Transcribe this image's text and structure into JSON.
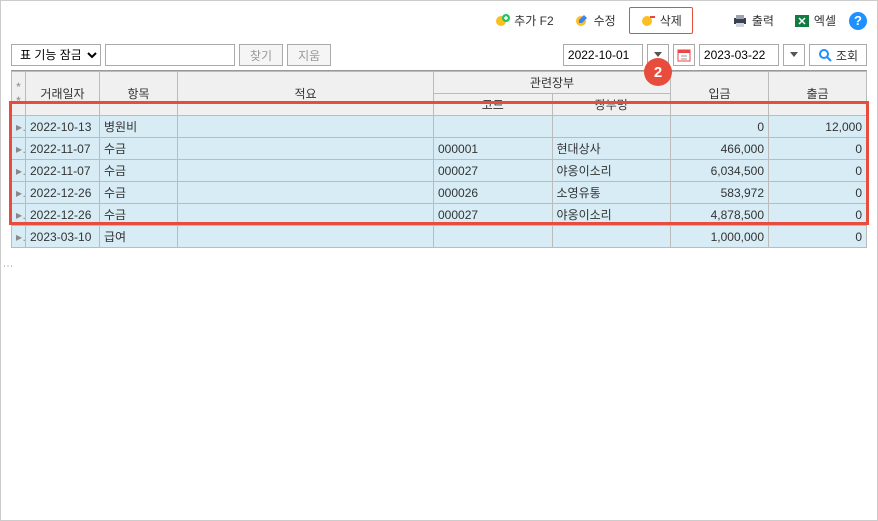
{
  "toolbar": {
    "add_label": "추가 F2",
    "edit_label": "수정",
    "delete_label": "삭제",
    "print_label": "출력",
    "excel_label": "엑셀",
    "help_glyph": "?"
  },
  "filter": {
    "lock_label": "표 기능 잠금",
    "find_label": "찾기",
    "clear_label": "지움",
    "date_from": "2022-10-01",
    "date_to": "2023-03-22",
    "search_label": "조회"
  },
  "columns": {
    "group_header": "관련장부",
    "date": "거래일자",
    "item": "항목",
    "memo": "적요",
    "code": "코드",
    "book": "장부명",
    "deposit": "입금",
    "withdraw": "출금"
  },
  "rows": [
    {
      "date": "2022-10-13",
      "item": "병원비",
      "memo": "",
      "code": "",
      "book": "",
      "deposit": "0",
      "withdraw": "12,000"
    },
    {
      "date": "2022-11-07",
      "item": "수금",
      "memo": "",
      "code": "000001",
      "book": "현대상사",
      "deposit": "466,000",
      "withdraw": "0"
    },
    {
      "date": "2022-11-07",
      "item": "수금",
      "memo": "",
      "code": "000027",
      "book": "야옹이소리",
      "deposit": "6,034,500",
      "withdraw": "0"
    },
    {
      "date": "2022-12-26",
      "item": "수금",
      "memo": "",
      "code": "000026",
      "book": "소영유통",
      "deposit": "583,972",
      "withdraw": "0"
    },
    {
      "date": "2022-12-26",
      "item": "수금",
      "memo": "",
      "code": "000027",
      "book": "야옹이소리",
      "deposit": "4,878,500",
      "withdraw": "0"
    },
    {
      "date": "2023-03-10",
      "item": "급여",
      "memo": "",
      "code": "",
      "book": "",
      "deposit": "1,000,000",
      "withdraw": "0"
    }
  ],
  "badge_number": "2"
}
